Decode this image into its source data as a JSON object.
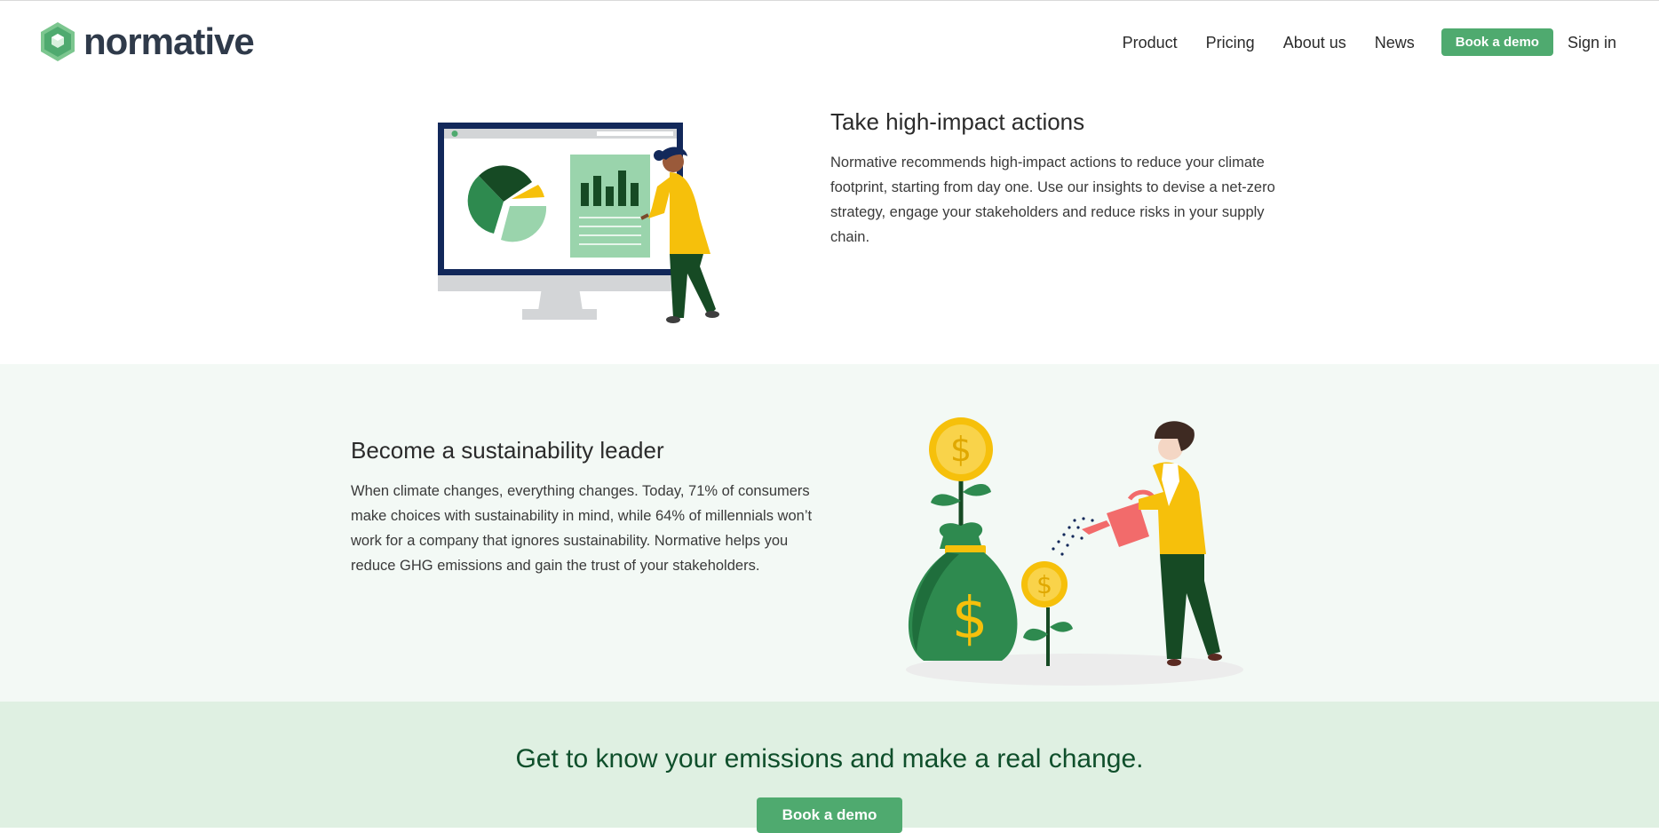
{
  "brand": {
    "name": "normative",
    "logo_icon": "hexagon-leaf-icon",
    "accent": "#4faa6f"
  },
  "nav": {
    "items": [
      {
        "label": "Product"
      },
      {
        "label": "Pricing"
      },
      {
        "label": "About us"
      },
      {
        "label": "News"
      }
    ],
    "demo_label": "Book a demo",
    "signin_label": "Sign in"
  },
  "section_actions": {
    "title": "Take high-impact actions",
    "body": "Normative recommends high-impact actions to reduce your climate footprint, starting from day one. Use our insights to devise a net-zero strategy, engage your stakeholders and reduce risks in your supply chain.",
    "illustration": "monitor-chart-person-illustration"
  },
  "section_leader": {
    "title": "Become a sustainability leader",
    "body": "When climate changes, everything changes. Today, 71% of consumers make choices with sustainability in mind, while 64% of millennials won’t work for a company that ignores sustainability. Normative helps you reduce GHG emissions and gain the trust of your stakeholders.",
    "illustration": "money-plant-watering-illustration"
  },
  "cta": {
    "title": "Get to know your emissions and make a real change.",
    "button_label": "Book a demo",
    "background": "#dff0e2"
  }
}
